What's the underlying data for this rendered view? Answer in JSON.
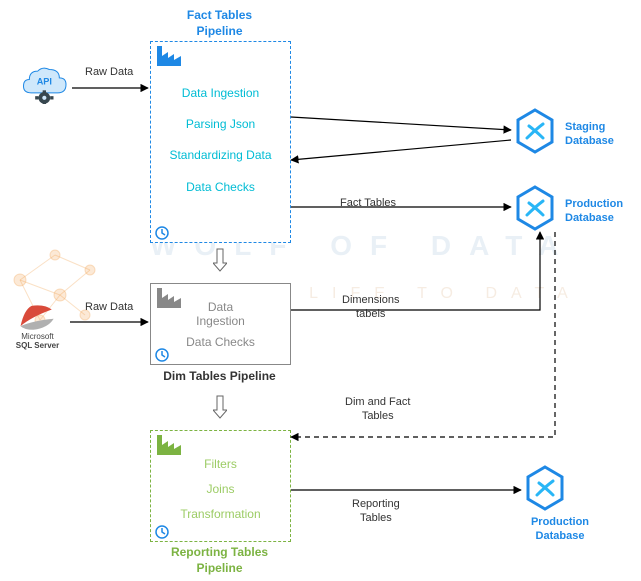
{
  "watermark": {
    "line1": "WOLF OF DATA",
    "line2": "BRING LIFE TO DATA"
  },
  "sources": {
    "api_label": "API",
    "sql_label": "SQL Server",
    "sql_vendor": "Microsoft"
  },
  "pipelines": {
    "fact": {
      "title": "Fact Tables\nPipeline",
      "items": [
        "Data Ingestion",
        "Parsing Json",
        "Standardizing Data",
        "Data Checks"
      ]
    },
    "dim": {
      "title": "Dim Tables Pipeline",
      "items": [
        "Data\nIngestion",
        "Data Checks"
      ]
    },
    "reporting": {
      "title": "Reporting Tables\nPipeline",
      "items": [
        "Filters",
        "Joins",
        "Transformation"
      ]
    }
  },
  "databases": {
    "staging": "Staging\nDatabase",
    "production": "Production\nDatabase"
  },
  "edges": {
    "raw_data": "Raw Data",
    "fact_tables": "Fact Tables",
    "dimensions_tables": "Dimensions\ntabels",
    "dim_and_fact": "Dim and Fact\nTables",
    "reporting_tables": "Reporting\nTables"
  },
  "colors": {
    "blue": "#1e88e5",
    "cyan": "#00bcd4",
    "green": "#7cb342",
    "grey": "#888888",
    "orange_wm": "#f2a65a"
  }
}
